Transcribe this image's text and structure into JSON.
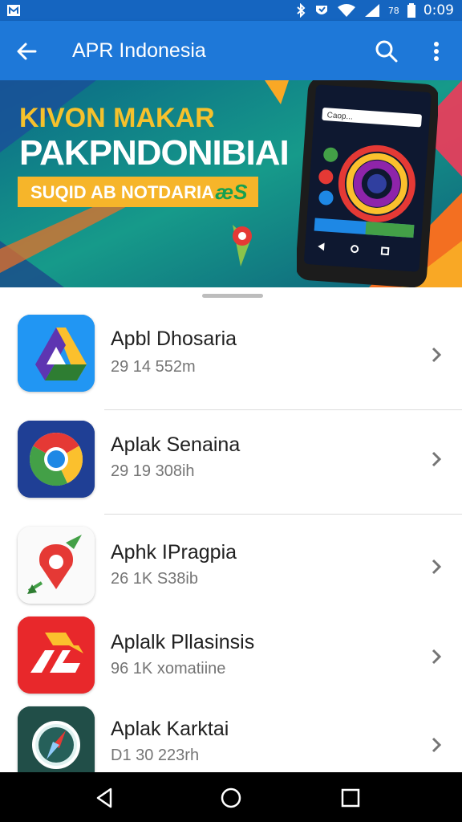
{
  "status_bar": {
    "time": "0:09",
    "battery": "78",
    "icons": [
      "notification-icon",
      "bluetooth-icon",
      "nfc-icon",
      "wifi-icon",
      "signal-icon",
      "battery-icon"
    ]
  },
  "app_bar": {
    "title": "APR Indonesia",
    "icons": [
      "back-arrow-icon",
      "search-icon",
      "more-vert-icon"
    ]
  },
  "banner": {
    "line1": "KIVON MAKAR",
    "line2": "PAKPNDONIBIAI",
    "line3": "SUQID AB NOTDARIA",
    "deco_text": "æS",
    "phone_search_text": "Caop...",
    "colors": {
      "teal": "#1a7a8a",
      "yellow": "#f6c12c",
      "orange": "#f6b52a"
    }
  },
  "apps": [
    {
      "name": "Apbl Dhosaria",
      "meta": "29 14 552m",
      "icon": "drive-style-icon"
    },
    {
      "name": "Aplak Senaina",
      "meta": "29 19 308ih",
      "icon": "chrome-style-icon"
    },
    {
      "name": "Aphk IPragpia",
      "meta": "26 1K S38ib",
      "icon": "map-pin-icon"
    },
    {
      "name": "Aplalk Pllasinsis",
      "meta": "96 1K xomatiine",
      "icon": "arrow-logo-icon"
    },
    {
      "name": "Aplak Karktai",
      "meta": "D1 30 223rh",
      "icon": "compass-icon"
    }
  ],
  "nav_bar": {
    "icons": [
      "back-triangle-icon",
      "home-circle-icon",
      "recents-square-icon"
    ]
  }
}
